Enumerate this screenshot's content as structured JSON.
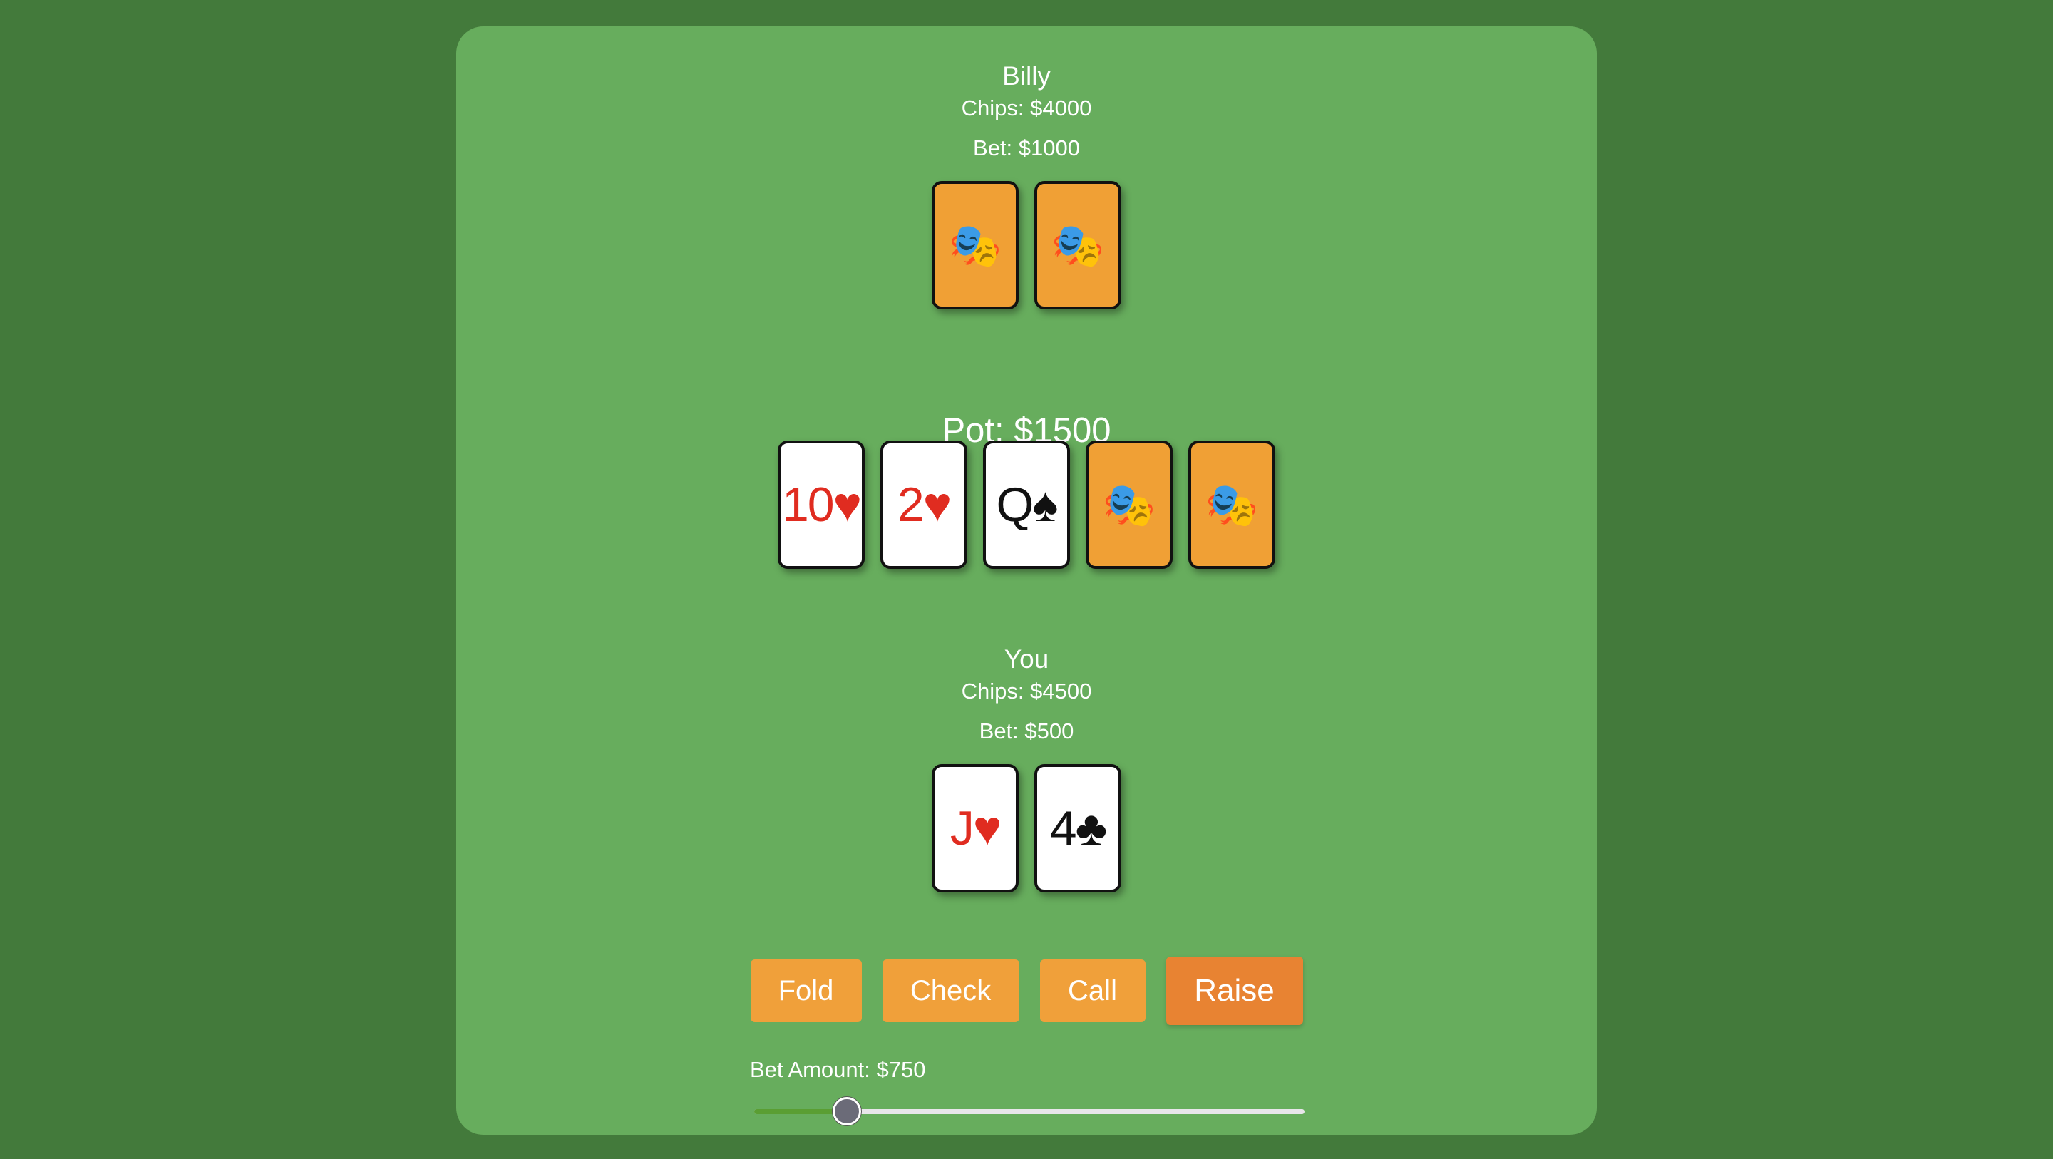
{
  "opponent": {
    "name": "Billy",
    "chips": "Chips: $4000",
    "bet": "Bet: $1000",
    "cards": [
      {
        "face": "back",
        "glyph": "🎭"
      },
      {
        "face": "back",
        "glyph": "🎭"
      }
    ]
  },
  "pot": "Pot: $1500",
  "community_cards": [
    {
      "face": "up",
      "text": "10♥",
      "suit_color": "red"
    },
    {
      "face": "up",
      "text": "2♥",
      "suit_color": "red"
    },
    {
      "face": "up",
      "text": "Q♠",
      "suit_color": "black"
    },
    {
      "face": "back",
      "glyph": "🎭"
    },
    {
      "face": "back",
      "glyph": "🎭"
    }
  ],
  "player": {
    "name": "You",
    "chips": "Chips: $4500",
    "bet": "Bet: $500",
    "cards": [
      {
        "face": "up",
        "text": "J♥",
        "suit_color": "red"
      },
      {
        "face": "up",
        "text": "4♣",
        "suit_color": "black"
      }
    ]
  },
  "actions": {
    "fold": "Fold",
    "check": "Check",
    "call": "Call",
    "raise": "Raise"
  },
  "bet_amount": {
    "label": "Bet Amount: $750",
    "slider_fraction": 0.168
  },
  "colors": {
    "background": "#437a3b",
    "table": "#67ad5d",
    "button": "#f0a03a",
    "button_active": "#e88332",
    "card_back": "#f0a035",
    "suit_red": "#e02c20"
  }
}
